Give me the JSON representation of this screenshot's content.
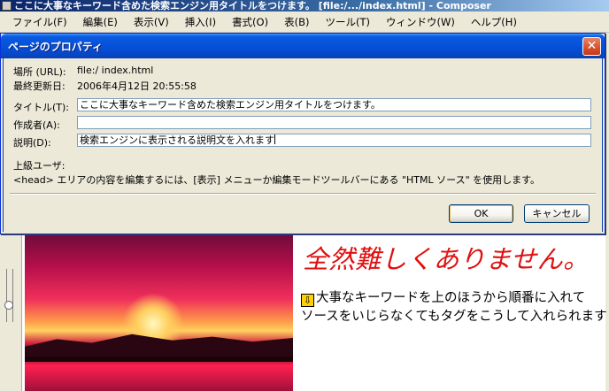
{
  "app": {
    "title": "ここに大事なキーワード含めた検索エンジン用タイトルをつけます。 [file:/.../index.html] - Composer",
    "menu": [
      "ファイル(F)",
      "編集(E)",
      "表示(V)",
      "挿入(I)",
      "書式(O)",
      "表(B)",
      "ツール(T)",
      "ウィンドウ(W)",
      "ヘルプ(H)"
    ]
  },
  "dialog": {
    "title": "ページのプロパティ",
    "location_label": "場所 (URL):",
    "location_value": "file:/ index.html",
    "modified_label": "最終更新日:",
    "modified_value": "2006年4月12日  20:55:58",
    "title_label": "タイトル(T):",
    "title_value": "ここに大事なキーワード含めた検索エンジン用タイトルをつけます。",
    "author_label": "作成者(A):",
    "author_value": "",
    "description_label": "説明(D):",
    "description_value": "検索エンジンに表示される説明文を入れます",
    "advanced_label": "上級ユーザ:",
    "advanced_text": "<head> エリアの内容を編集するには、[表示] メニューか編集モードツールバーにある \"HTML ソース\" を使用します。",
    "ok_label": "OK",
    "cancel_label": "キャンセル",
    "close_glyph": "✕"
  },
  "document": {
    "heading": "全然難しくありません。",
    "line1": "大事なキーワードを上のほうから順番に入れて",
    "line2": "ソースをいじらなくてもタグをこうして入れられます",
    "pointer_glyph": "⇩"
  },
  "colors": {
    "heading": "#e01010",
    "dialog_title_bar": "#0550d8",
    "dialog_background": "#ece9d8",
    "close_button": "#d8502a"
  }
}
